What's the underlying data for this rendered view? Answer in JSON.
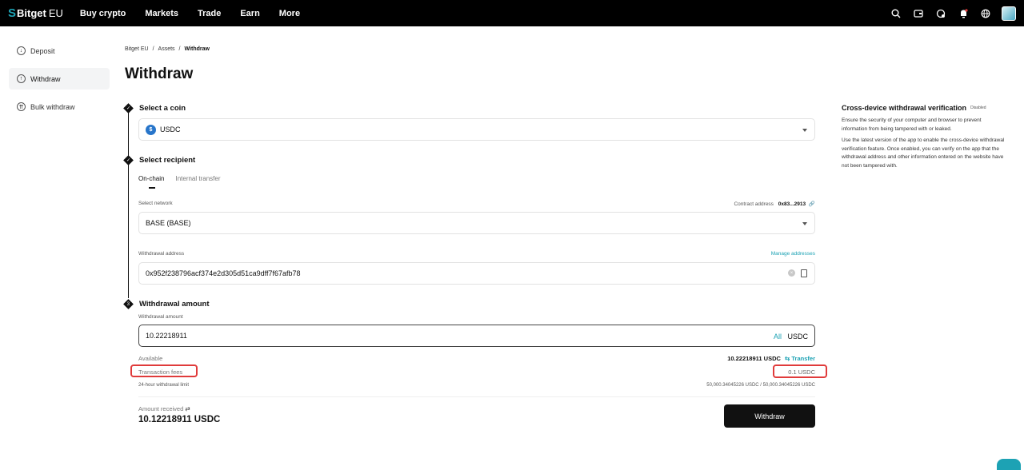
{
  "header": {
    "logo": "Bitget",
    "logo_suffix": "EU",
    "nav": [
      "Buy crypto",
      "Markets",
      "Trade",
      "Earn",
      "More"
    ]
  },
  "sidebar": {
    "items": [
      {
        "label": "Deposit",
        "icon": "deposit-icon"
      },
      {
        "label": "Withdraw",
        "icon": "withdraw-icon"
      },
      {
        "label": "Bulk withdraw",
        "icon": "bulk-withdraw-icon"
      }
    ]
  },
  "breadcrumb": [
    "Bitget EU",
    "Assets",
    "Withdraw"
  ],
  "page_title": "Withdraw",
  "steps": {
    "coin": {
      "label": "Select a coin",
      "value": "USDC"
    },
    "recipient": {
      "label": "Select recipient",
      "tabs": [
        "On-chain",
        "Internal transfer"
      ],
      "network_label": "Select network",
      "network_value": "BASE (BASE)",
      "contract_label": "Contract address",
      "contract_value": "0x83...2913",
      "address_label": "Withdrawal address",
      "manage_label": "Manage addresses",
      "address_value": "0x952f238796acf374e2d305d51ca9dff7f67afb78"
    },
    "amount": {
      "label": "Withdrawal amount",
      "field_label": "Withdrawal amount",
      "value": "10.22218911",
      "all_label": "All",
      "unit": "USDC",
      "available_label": "Available",
      "available_value": "10.22218911 USDC",
      "transfer_label": "Transfer",
      "fees_label": "Transaction fees",
      "fees_value": "0.1 USDC",
      "limit_label": "24-hour withdrawal limit",
      "limit_value": "50,000.34045226 USDC / 50,000.34045226 USDC",
      "received_label": "Amount received",
      "received_value": "10.12218911 USDC",
      "button": "Withdraw"
    }
  },
  "verification": {
    "title": "Cross-device withdrawal verification",
    "status": "Disabled",
    "p1": "Ensure the security of your computer and browser to prevent information from being tampered with or leaked.",
    "p2": "Use the latest version of the app to enable the cross-device withdrawal verification feature. Once enabled, you can verify on the app that the withdrawal address and other information entered on the website have not been tampered with."
  },
  "colors": {
    "accent": "#1da2b4",
    "highlight": "#e03b3b"
  }
}
